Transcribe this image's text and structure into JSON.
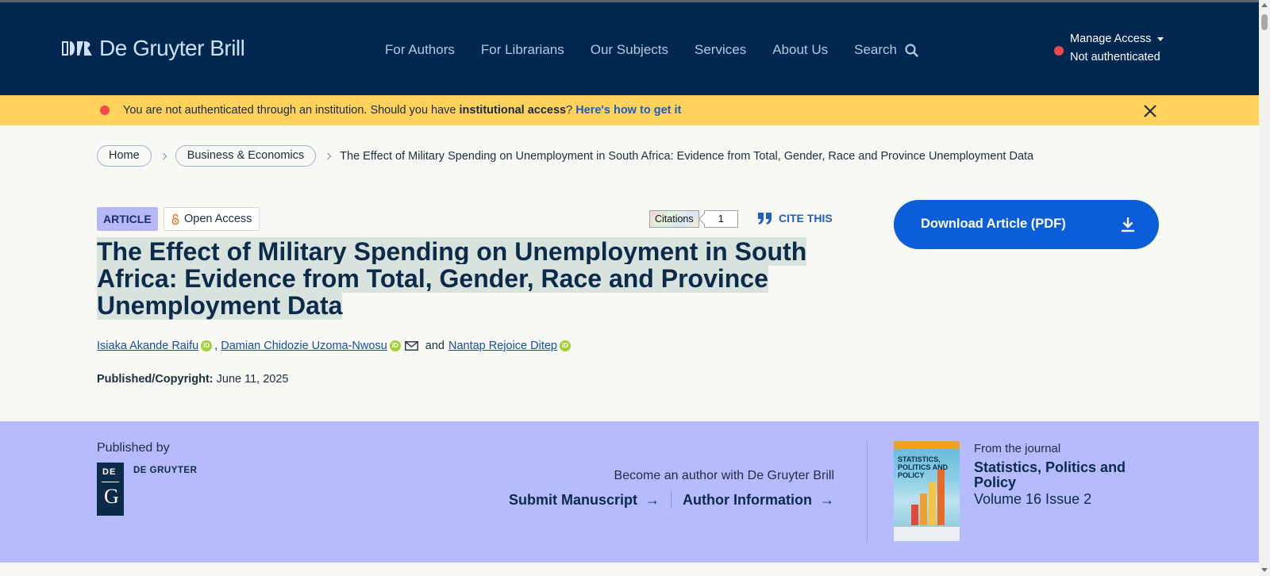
{
  "header": {
    "logo_text": "De Gruyter Brill",
    "nav": [
      "For Authors",
      "For Librarians",
      "Our Subjects",
      "Services",
      "About Us"
    ],
    "search_label": "Search",
    "access": {
      "title": "Manage Access",
      "status": "Not authenticated"
    }
  },
  "banner": {
    "text_before": "You are not authenticated through an institution. Should you have ",
    "text_bold": "institutional access",
    "text_after": "? ",
    "link": "Here's how to get it"
  },
  "breadcrumb": {
    "home": "Home",
    "category": "Business & Economics",
    "current": "The Effect of Military Spending on Unemployment in South Africa: Evidence from Total, Gender, Race and Province Unemployment Data"
  },
  "article": {
    "type_badge": "ARTICLE",
    "access_badge": "Open Access",
    "citations_label": "Citations",
    "citations_count": "1",
    "cite_label": "CITE THIS",
    "download_label": "Download Article (PDF)",
    "title_lines": [
      "The Effect of Military Spending on Unemployment in South",
      "Africa: Evidence from Total, Gender, Race and Province",
      "Unemployment Data"
    ],
    "authors": [
      "Isiaka Akande Raifu",
      "Damian Chidozie Uzoma-Nwosu",
      "Nantap Rejoice Ditep"
    ],
    "and_text": "and",
    "published_label": "Published/Copyright:",
    "published_date": "June 11, 2025"
  },
  "band": {
    "published_by": "Published by",
    "publisher_name": "DE GRUYTER",
    "publisher_logo_top": "DE",
    "publisher_logo_letter": "G",
    "become_author": "Become an author with De Gruyter Brill",
    "submit_label": "Submit Manuscript",
    "author_info_label": "Author Information",
    "arrow": "→",
    "journal_from": "From the journal",
    "journal_name": "Statistics, Politics and Policy",
    "journal_volume": "Volume 16 Issue 2",
    "cover_title": "STATISTICS, POLITICS AND POLICY"
  },
  "colors": {
    "header_bg": "#00274f",
    "banner_bg": "#ffd25c",
    "band_bg": "#b6bbfe",
    "primary_button": "#0b5ed7",
    "alert_dot": "#ee4a4a"
  },
  "icons": {
    "search": "search-icon",
    "close": "close-icon",
    "open_access": "open-access-lock-icon",
    "quote": "quote-icon",
    "download": "download-icon",
    "orcid": "orcid-icon",
    "mail": "mail-icon"
  }
}
